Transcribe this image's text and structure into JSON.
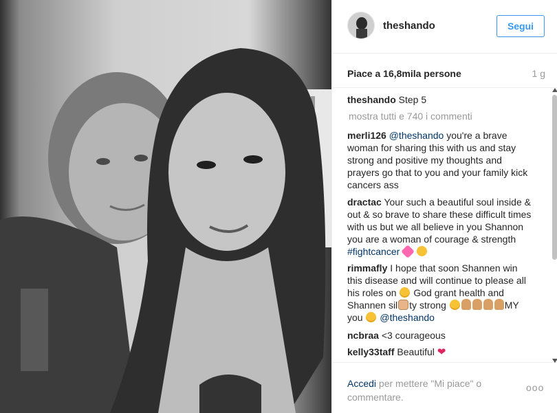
{
  "post": {
    "username": "theshando",
    "follow_label": "Segui",
    "likes": "Piace a 16,8mila persone",
    "time": "1 g",
    "caption": {
      "user": "theshando",
      "text": "Step 5"
    },
    "show_all": "mostra tutti e 740 i commenti",
    "comments": [
      {
        "user": "merli126",
        "tag": "@theshando",
        "text": "you're a brave woman for sharing this with us and stay strong and positive my thoughts and prayers go that to you and your family kick cancers ass"
      },
      {
        "user": "dractac",
        "text": "Your such a beautiful soul inside & out & so brave to share these difficult times with us but we all believe in you Shannon you are a woman of courage & strength",
        "tag": "#fightcancer"
      },
      {
        "user": "rimmafly",
        "text_1": "I hope that soon Shannen win this disease and will continue to please all his roles on",
        "text_2": "God grant health and Shannen sil",
        "text_3": "ty strong",
        "text_4": "MY you",
        "tag": "@theshando"
      },
      {
        "user": "ncbraa",
        "text": "<3 courageous"
      },
      {
        "user": "kelly33taff",
        "text": "Beautiful"
      }
    ],
    "footer": {
      "login_link": "Accedi",
      "login_text": "per mettere \"Mi piace\" o commentare.",
      "more": "ooo"
    }
  },
  "icons": {
    "heart_emoji": "red-heart-icon",
    "smile_emoji": "smiling-face-icon",
    "praying_emoji": "praying-hands-icon",
    "kiss_emoji": "kissing-face-icon",
    "sparkling_heart_emoji": "sparkling-heart-icon",
    "fist_emoji": "fist-icon"
  },
  "colors": {
    "accent": "#3897f0",
    "link": "#003569",
    "muted": "#999999",
    "text": "#262626"
  }
}
